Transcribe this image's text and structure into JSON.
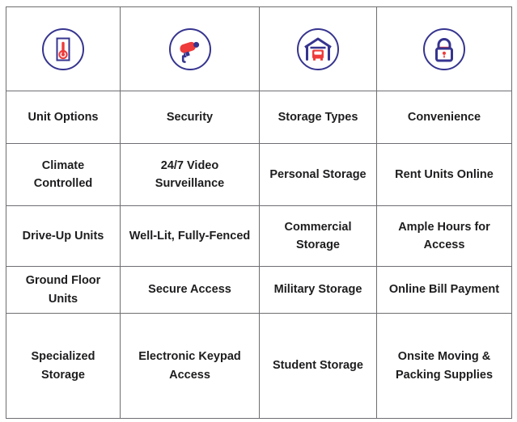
{
  "table": {
    "colors": {
      "border": "#6e6e73",
      "text": "#1d1d1f",
      "icon_navy": "#36348f",
      "icon_red": "#ef3b3b",
      "background": "#ffffff"
    },
    "icons": [
      {
        "name": "thermometer-icon",
        "label": "Climate control thermometer"
      },
      {
        "name": "security-camera-icon",
        "label": "Security surveillance camera"
      },
      {
        "name": "covered-parking-icon",
        "label": "Carport with recreational vehicle"
      },
      {
        "name": "padlock-icon",
        "label": "Closed padlock"
      }
    ],
    "headers": [
      "Unit Options",
      "Security",
      "Storage Types",
      "Convenience"
    ],
    "rows": [
      [
        "Climate Controlled",
        "24/7 Video Surveillance",
        "Personal Storage",
        "Rent Units Online"
      ],
      [
        "Drive-Up Units",
        "Well-Lit, Fully-Fenced",
        "Commercial Storage",
        "Ample Hours for Access"
      ],
      [
        "Ground Floor Units",
        "Secure Access",
        "Military Storage",
        "Online Bill Payment"
      ],
      [
        "Specialized Storage",
        "Electronic Keypad Access",
        "Student Storage",
        "Onsite Moving & Packing Supplies"
      ]
    ]
  }
}
